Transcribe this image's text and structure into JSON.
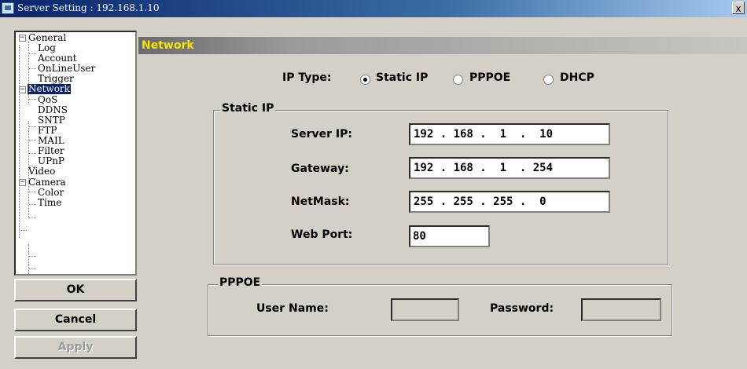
{
  "window": {
    "title": "Server Setting : 192.168.1.10",
    "close_glyph": "x",
    "icon": "server-setting-icon"
  },
  "tree": {
    "general": "General",
    "log": "Log",
    "account": "Account",
    "onlineuser": "OnLineUser",
    "trigger": "Trigger",
    "network": "Network",
    "qos": "QoS",
    "ddns": "DDNS",
    "sntp": "SNTP",
    "ftp": "FTP",
    "mail": "MAIL",
    "filter": "Filter",
    "upnp": "UPnP",
    "video": "Video",
    "camera": "Camera",
    "color": "Color",
    "time": "Time",
    "collapse_glyph": "−"
  },
  "buttons": {
    "ok": "OK",
    "cancel": "Cancel",
    "apply": "Apply"
  },
  "header": {
    "title": "Network",
    "title_color": "#f5e600"
  },
  "ip_type": {
    "label": "IP Type:",
    "options": [
      "Static IP",
      "PPPOE",
      "DHCP"
    ],
    "selected": "Static IP"
  },
  "static_ip": {
    "group_title": "Static IP",
    "server_ip_label": "Server IP:",
    "server_ip": "192 . 168 .  1  .  10",
    "gateway_label": "Gateway:",
    "gateway": "192 . 168 .  1  . 254",
    "netmask_label": "NetMask:",
    "netmask": "255 . 255 . 255 .  0",
    "web_port_label": "Web Port:",
    "web_port": "80"
  },
  "pppoe": {
    "group_title": "PPPOE",
    "user_name_label": "User Name:",
    "user_name": "",
    "password_label": "Password:",
    "password": ""
  }
}
